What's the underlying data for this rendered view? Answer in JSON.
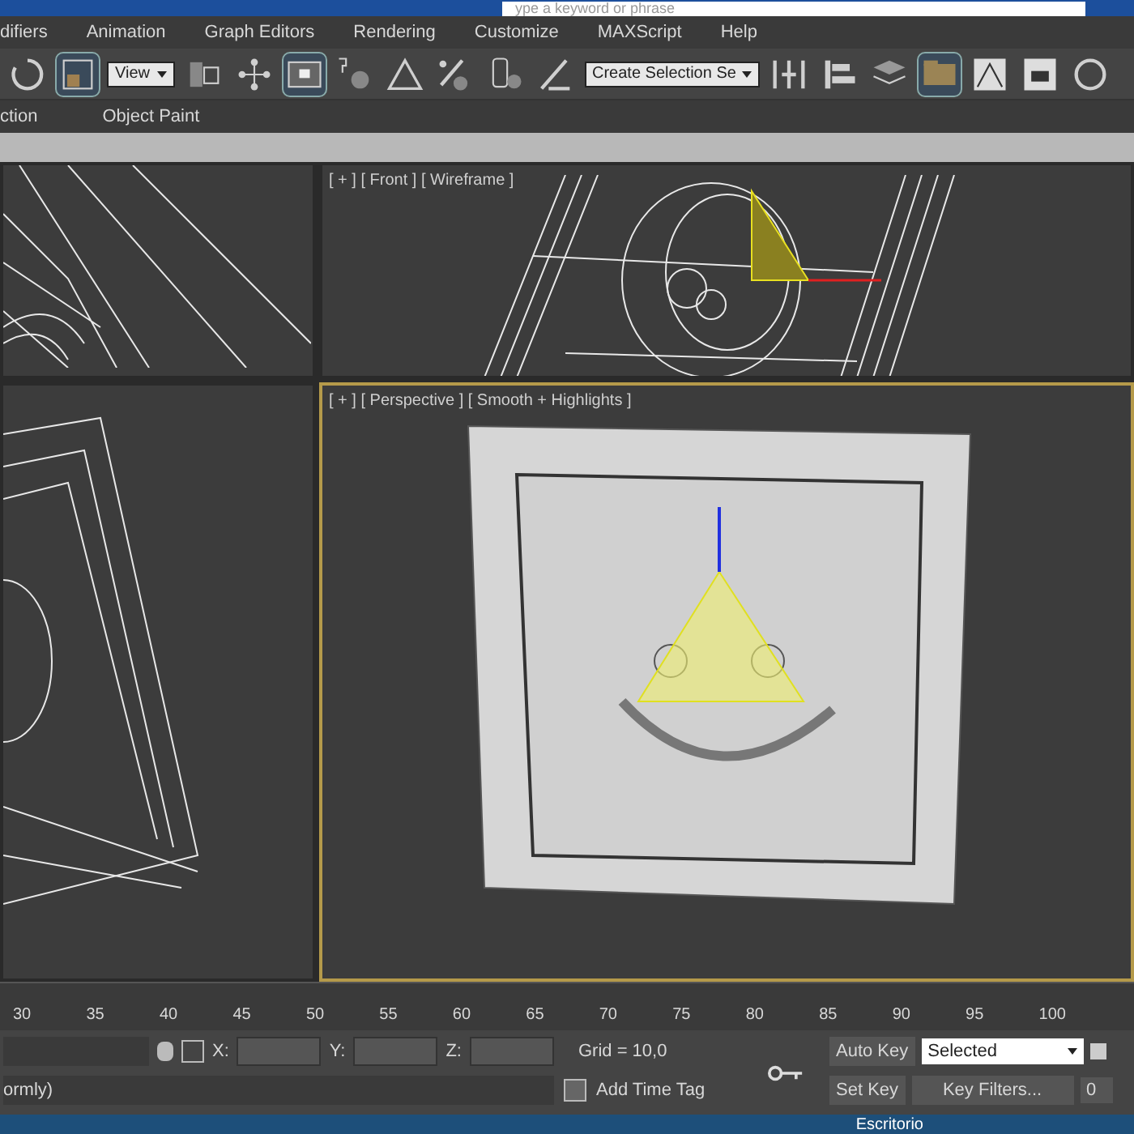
{
  "title_bar": {
    "search_placeholder": "ype a keyword or phrase"
  },
  "menu_bar": [
    "difiers",
    "Animation",
    "Graph Editors",
    "Rendering",
    "Customize",
    "MAXScript",
    "Help"
  ],
  "toolbar": [
    {
      "kind": "icon",
      "selected": false
    },
    {
      "kind": "icon",
      "selected": true
    },
    {
      "kind": "dropdown",
      "value": "View"
    },
    {
      "kind": "icon",
      "selected": false
    },
    {
      "kind": "icon",
      "selected": false
    },
    {
      "kind": "icon",
      "selected": true
    },
    {
      "kind": "icon",
      "selected": false
    },
    {
      "kind": "icon",
      "selected": false
    },
    {
      "kind": "icon",
      "selected": false
    },
    {
      "kind": "icon",
      "selected": false
    },
    {
      "kind": "icon",
      "selected": false
    },
    {
      "kind": "dropdown",
      "value": "Create Selection Se"
    },
    {
      "kind": "icon",
      "selected": false
    },
    {
      "kind": "icon",
      "selected": false
    },
    {
      "kind": "icon",
      "selected": false
    },
    {
      "kind": "icon",
      "selected": true
    },
    {
      "kind": "icon",
      "selected": false
    },
    {
      "kind": "icon",
      "selected": false
    },
    {
      "kind": "icon",
      "selected": false
    }
  ],
  "ribbon": [
    "ction",
    "Object Paint"
  ],
  "viewports": [
    {
      "kind": "left",
      "active": false
    },
    {
      "kind": "front",
      "label": "[ + ] [ Front ] [ Wireframe ]",
      "active": false
    },
    {
      "kind": "leftbottom",
      "active": false
    },
    {
      "kind": "perspective",
      "label": "[ + ] [ Perspective ] [ Smooth + Highlights ]",
      "active": true
    }
  ],
  "timeline": [
    "30",
    "35",
    "40",
    "45",
    "50",
    "55",
    "60",
    "65",
    "70",
    "75",
    "80",
    "85",
    "90",
    "95",
    "100"
  ],
  "status": {
    "prompt": "ormly)",
    "x_label": "X:",
    "y_label": "Y:",
    "z_label": "Z:",
    "grid": "Grid = 10,0",
    "add_time_tag": "Add Time Tag",
    "auto_key": "Auto Key",
    "key_mode": "Selected",
    "set_key": "Set Key",
    "key_filters": "Key Filters...",
    "frame": "0"
  },
  "taskbar": {
    "label": "Escritorio"
  }
}
